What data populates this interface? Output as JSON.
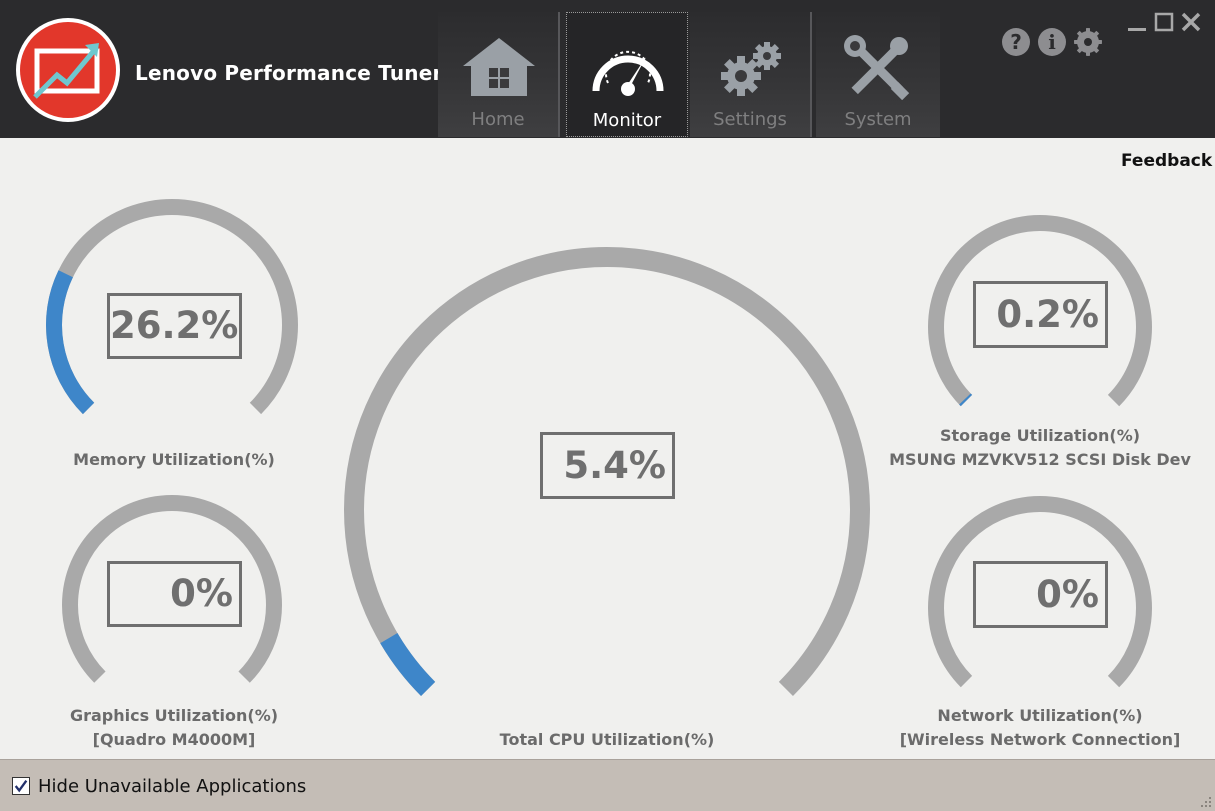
{
  "app": {
    "title": "Lenovo Performance Tuner"
  },
  "nav": {
    "tabs": [
      {
        "label": "Home",
        "icon": "home-icon",
        "active": false
      },
      {
        "label": "Monitor",
        "icon": "speedometer-icon",
        "active": true
      },
      {
        "label": "Settings",
        "icon": "gears-icon",
        "active": false
      },
      {
        "label": "System",
        "icon": "tools-icon",
        "active": false
      }
    ]
  },
  "toolbar": {
    "help": "?",
    "info": "i"
  },
  "feedback_label": "Feedback",
  "gauges": {
    "memory": {
      "value": 26.2,
      "value_text": "26.2%",
      "label_line1": "Memory Utilization(%)",
      "label_line2": ""
    },
    "graphics": {
      "value": 0,
      "value_text": "0%",
      "label_line1": "Graphics Utilization(%)",
      "label_line2": "[Quadro M4000M]"
    },
    "cpu": {
      "value": 5.4,
      "value_text": "5.4%",
      "label_line1": "Total CPU Utilization(%)",
      "label_line2": ""
    },
    "storage": {
      "value": 0.2,
      "value_text": "0.2%",
      "label_line1": "Storage Utilization(%)",
      "label_line2": "MSUNG MZVKV512 SCSI Disk Dev"
    },
    "network": {
      "value": 0,
      "value_text": "0%",
      "label_line1": "Network Utilization(%)",
      "label_line2": "[Wireless Network Connection]"
    }
  },
  "colors": {
    "track": "#a9a9a9",
    "fill": "#3e86c9",
    "header": "#2b2b2d",
    "accent": "#e2372b"
  },
  "footer": {
    "hide_unavailable_label": "Hide Unavailable Applications",
    "hide_unavailable_checked": true
  }
}
